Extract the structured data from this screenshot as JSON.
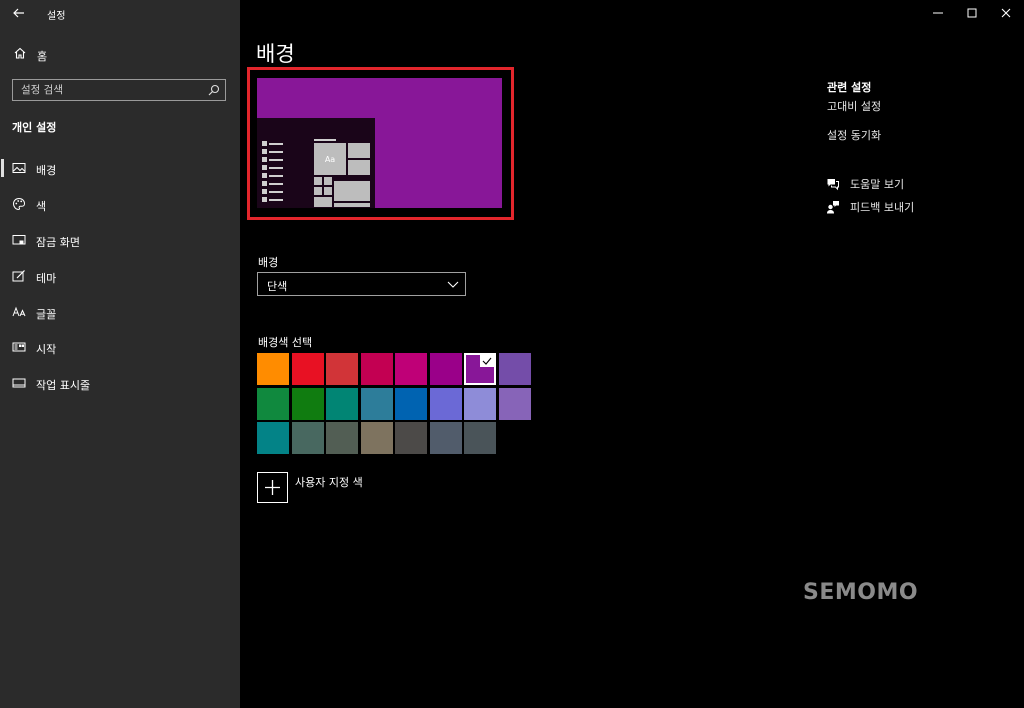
{
  "app": {
    "title": "설정"
  },
  "nav": {
    "home_label": "홈",
    "search_placeholder": "설정 검색",
    "section_header": "개인 설정",
    "items": [
      {
        "label": "배경",
        "icon": "image-icon",
        "active": true
      },
      {
        "label": "색",
        "icon": "palette-icon",
        "active": false
      },
      {
        "label": "잠금 화면",
        "icon": "lock-screen-icon",
        "active": false
      },
      {
        "label": "테마",
        "icon": "theme-icon",
        "active": false
      },
      {
        "label": "글꼴",
        "icon": "font-icon",
        "active": false
      },
      {
        "label": "시작",
        "icon": "start-icon",
        "active": false
      },
      {
        "label": "작업 표시줄",
        "icon": "taskbar-icon",
        "active": false
      }
    ]
  },
  "main": {
    "page_title": "배경",
    "preview": {
      "bg_color": "#881798",
      "sample_text": "Aa"
    },
    "background_label": "배경",
    "background_value": "단색",
    "color_picker_label": "배경색 선택",
    "colors": [
      [
        "#ff8c00",
        "#e81123",
        "#d13438",
        "#c30052",
        "#bf0077",
        "#9a0089",
        "#881798",
        "#744da9"
      ],
      [
        "#10893e",
        "#107c10",
        "#018574",
        "#2d7d9a",
        "#0063b1",
        "#6b69d6",
        "#8e8cd8",
        "#8764b8"
      ],
      [
        "#038387",
        "#486860",
        "#525e54",
        "#7e735f",
        "#4c4a48",
        "#515c6b",
        "#4a5459"
      ]
    ],
    "selected_color": "#881798",
    "custom_color_label": "사용자 지정 색"
  },
  "related": {
    "title": "관련 설정",
    "links": [
      "고대비 설정",
      "설정 동기화"
    ],
    "help_label": "도움말 보기",
    "feedback_label": "피드백 보내기"
  },
  "watermark": "SEMOMO",
  "theme": {
    "sidebar_bg": "#2b2b2b",
    "frame_highlight": "#e3262c"
  }
}
